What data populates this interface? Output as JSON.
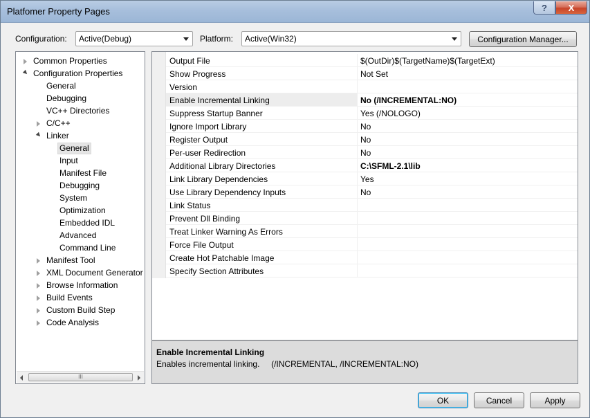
{
  "window": {
    "title": "Platfomer Property Pages",
    "help_label": "?",
    "close_label": "X"
  },
  "toolbar": {
    "configuration_label": "Configuration:",
    "configuration_value": "Active(Debug)",
    "platform_label": "Platform:",
    "platform_value": "Active(Win32)",
    "config_manager_label": "Configuration Manager..."
  },
  "tree": {
    "items": [
      {
        "label": "Common Properties",
        "expander": "closed"
      },
      {
        "label": "Configuration Properties",
        "expander": "open"
      },
      {
        "label": "General",
        "expander": "none"
      },
      {
        "label": "Debugging",
        "expander": "none"
      },
      {
        "label": "VC++ Directories",
        "expander": "none"
      },
      {
        "label": "C/C++",
        "expander": "closed"
      },
      {
        "label": "Linker",
        "expander": "open"
      },
      {
        "label": "General",
        "expander": "none",
        "selected": true
      },
      {
        "label": "Input",
        "expander": "none"
      },
      {
        "label": "Manifest File",
        "expander": "none"
      },
      {
        "label": "Debugging",
        "expander": "none"
      },
      {
        "label": "System",
        "expander": "none"
      },
      {
        "label": "Optimization",
        "expander": "none"
      },
      {
        "label": "Embedded IDL",
        "expander": "none"
      },
      {
        "label": "Advanced",
        "expander": "none"
      },
      {
        "label": "Command Line",
        "expander": "none"
      },
      {
        "label": "Manifest Tool",
        "expander": "closed"
      },
      {
        "label": "XML Document Generator",
        "expander": "closed"
      },
      {
        "label": "Browse Information",
        "expander": "closed"
      },
      {
        "label": "Build Events",
        "expander": "closed"
      },
      {
        "label": "Custom Build Step",
        "expander": "closed"
      },
      {
        "label": "Code Analysis",
        "expander": "closed"
      }
    ],
    "scroll_grip": "III"
  },
  "properties": [
    {
      "name": "Output File",
      "value": "$(OutDir)$(TargetName)$(TargetExt)",
      "bold": false
    },
    {
      "name": "Show Progress",
      "value": "Not Set",
      "bold": false
    },
    {
      "name": "Version",
      "value": "",
      "bold": false
    },
    {
      "name": "Enable Incremental Linking",
      "value": "No (/INCREMENTAL:NO)",
      "bold": true,
      "selected": true
    },
    {
      "name": "Suppress Startup Banner",
      "value": "Yes (/NOLOGO)",
      "bold": false
    },
    {
      "name": "Ignore Import Library",
      "value": "No",
      "bold": false
    },
    {
      "name": "Register Output",
      "value": "No",
      "bold": false
    },
    {
      "name": "Per-user Redirection",
      "value": "No",
      "bold": false
    },
    {
      "name": "Additional Library Directories",
      "value": "C:\\SFML-2.1\\lib",
      "bold": true
    },
    {
      "name": "Link Library Dependencies",
      "value": "Yes",
      "bold": false
    },
    {
      "name": "Use Library Dependency Inputs",
      "value": "No",
      "bold": false
    },
    {
      "name": "Link Status",
      "value": "",
      "bold": false
    },
    {
      "name": "Prevent Dll Binding",
      "value": "",
      "bold": false
    },
    {
      "name": "Treat Linker Warning As Errors",
      "value": "",
      "bold": false
    },
    {
      "name": "Force File Output",
      "value": "",
      "bold": false
    },
    {
      "name": "Create Hot Patchable Image",
      "value": "",
      "bold": false
    },
    {
      "name": "Specify Section Attributes",
      "value": "",
      "bold": false
    }
  ],
  "description": {
    "title": "Enable Incremental Linking",
    "text": "Enables incremental linking.     (/INCREMENTAL, /INCREMENTAL:NO)"
  },
  "buttons": {
    "ok": "OK",
    "cancel": "Cancel",
    "apply": "Apply"
  }
}
